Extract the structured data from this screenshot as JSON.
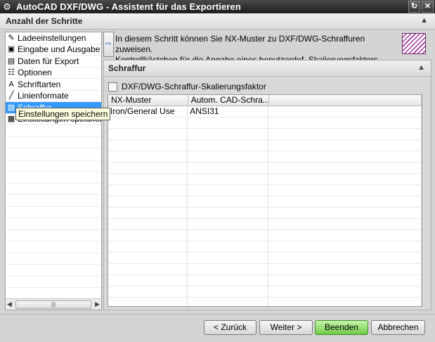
{
  "window": {
    "title": "AutoCAD DXF/DWG - Assistent für das Exportieren"
  },
  "steps_header": {
    "label": "Anzahl der Schritte"
  },
  "steps": [
    {
      "label": "Ladeeinstellungen",
      "icon": "wrench-icon",
      "glyph": "✎"
    },
    {
      "label": "Eingabe und Ausgabe",
      "icon": "folder-icon",
      "glyph": "▣"
    },
    {
      "label": "Daten für Export",
      "icon": "document-icon",
      "glyph": "▤"
    },
    {
      "label": "Optionen",
      "icon": "options-icon",
      "glyph": "☷"
    },
    {
      "label": "Schriftarten",
      "icon": "font-icon",
      "glyph": "A"
    },
    {
      "label": "Linienformate",
      "icon": "line-icon",
      "glyph": "╱"
    },
    {
      "label": "Schraffur",
      "icon": "hatch-icon",
      "glyph": "▧"
    },
    {
      "label": "Einstellungen speichern",
      "icon": "save-settings-icon",
      "glyph": "▩"
    }
  ],
  "tooltip": {
    "text": "Einstellungen speichern"
  },
  "info": {
    "line1": "In diesem Schritt können Sie NX-Muster zu DXF/DWG-Schraffuren zuweisen.",
    "line2": "Kontrollkästchen für die Angabe eines benutzerdef. Skalierungsfaktors aktivieren."
  },
  "panel": {
    "title": "Schraffur",
    "checkbox_label": "DXF/DWG-Schraffur-Skalierungsfaktor",
    "columns": [
      "NX-Muster",
      "Autom. CAD-Schra...",
      ""
    ],
    "rows": [
      [
        "Iron/General Use",
        "ANSI31",
        ""
      ]
    ]
  },
  "buttons": {
    "back": "< Zurück",
    "next": "Weiter >",
    "finish": "Beenden",
    "cancel": "Abbrechen"
  }
}
